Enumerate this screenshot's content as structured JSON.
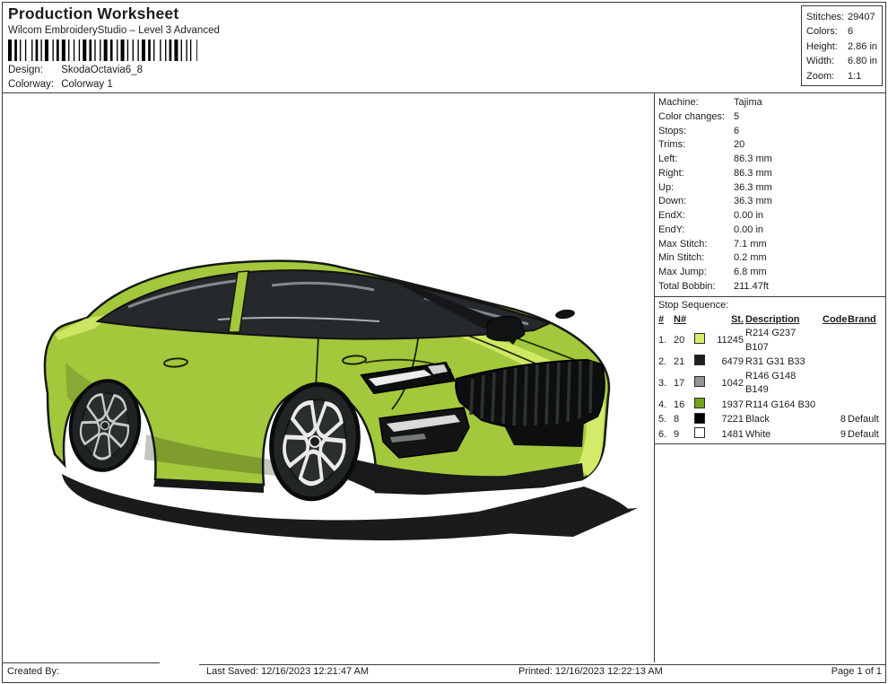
{
  "header": {
    "title": "Production Worksheet",
    "subtitle": "Wilcom EmbroideryStudio – Level 3 Advanced",
    "design_label": "Design:",
    "design_value": "SkodaOctavia6_8",
    "colorway_label": "Colorway:",
    "colorway_value": "Colorway 1"
  },
  "summary_box": {
    "rows": [
      {
        "label": "Stitches:",
        "value": "29407"
      },
      {
        "label": "Colors:",
        "value": "6"
      },
      {
        "label": "Height:",
        "value": "2.86 in"
      },
      {
        "label": "Width:",
        "value": "6.80 in"
      },
      {
        "label": "Zoom:",
        "value": "1:1"
      }
    ]
  },
  "machine_info": {
    "rows": [
      {
        "label": "Machine:",
        "value": "Tajima"
      },
      {
        "label": "Color changes:",
        "value": "5"
      },
      {
        "label": "Stops:",
        "value": "6"
      },
      {
        "label": "Trims:",
        "value": "20"
      },
      {
        "label": "Left:",
        "value": "86.3 mm"
      },
      {
        "label": "Right:",
        "value": "86.3 mm"
      },
      {
        "label": "Up:",
        "value": "36.3 mm"
      },
      {
        "label": "Down:",
        "value": "36.3 mm"
      },
      {
        "label": "EndX:",
        "value": "0.00 in"
      },
      {
        "label": "EndY:",
        "value": "0.00 in"
      },
      {
        "label": "Max Stitch:",
        "value": "7.1 mm"
      },
      {
        "label": "Min Stitch:",
        "value": "0.2 mm"
      },
      {
        "label": "Max Jump:",
        "value": "6.8 mm"
      },
      {
        "label": "Total Bobbin:",
        "value": "211.47ft"
      }
    ]
  },
  "stop_sequence": {
    "title": "Stop Sequence:",
    "columns": [
      "#",
      "N#",
      "St.",
      "Description",
      "Code",
      "Brand"
    ],
    "rows": [
      {
        "num": "1.",
        "n": "20",
        "color": "#D6ED6B",
        "st": "11245",
        "description": "R214 G237 B107",
        "code": "",
        "brand": ""
      },
      {
        "num": "2.",
        "n": "21",
        "color": "#1F1F21",
        "st": "6479",
        "description": "R31 G31 B33",
        "code": "",
        "brand": ""
      },
      {
        "num": "3.",
        "n": "17",
        "color": "#929495",
        "st": "1042",
        "description": "R146 G148 B149",
        "code": "",
        "brand": ""
      },
      {
        "num": "4.",
        "n": "16",
        "color": "#72A41E",
        "st": "1937",
        "description": "R114 G164 B30",
        "code": "",
        "brand": ""
      },
      {
        "num": "5.",
        "n": "8",
        "color": "#000000",
        "st": "7221",
        "description": "Black",
        "code": "8",
        "brand": "Default"
      },
      {
        "num": "6.",
        "n": "9",
        "color": "#FFFFFF",
        "st": "1481",
        "description": "White",
        "code": "9",
        "brand": "Default"
      }
    ]
  },
  "artwork": {
    "subject": "Skoda Octavia RS embroidery stitch preview, front three-quarter view",
    "body_color": "#A3C83C",
    "body_highlight": "#D6ED6B",
    "dark_color": "#17191A",
    "glass_color": "#26292B"
  },
  "footer": {
    "created_by": "Created By:",
    "last_saved": "Last Saved: 12/16/2023 12:21:47 AM",
    "printed": "Printed: 12/16/2023 12:22:13 AM",
    "page": "Page 1 of 1"
  }
}
